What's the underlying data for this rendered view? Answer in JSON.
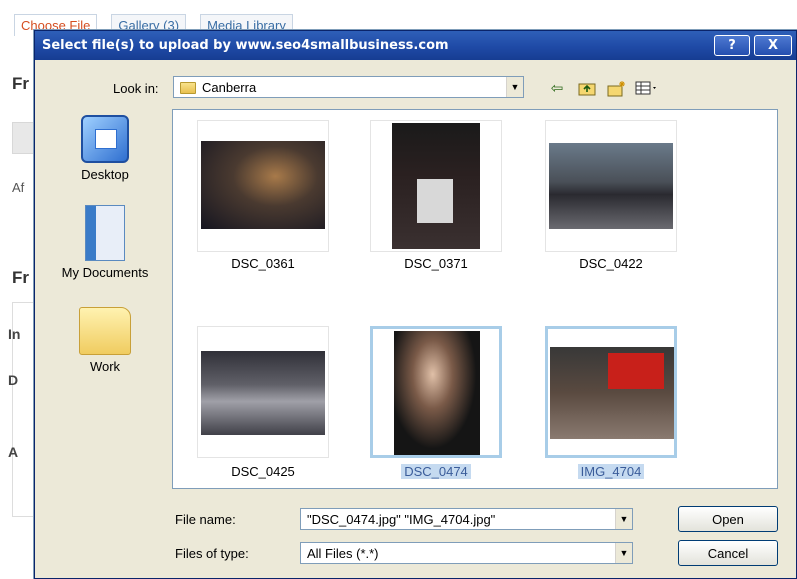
{
  "background": {
    "tabs": [
      "Choose File",
      "Gallery (3)",
      "Media Library"
    ],
    "headings": [
      "Fr",
      "Fr"
    ],
    "text": "Af",
    "panel_labels": [
      "In",
      "D",
      "A"
    ]
  },
  "dialog": {
    "title": "Select file(s) to upload by www.seo4smallbusiness.com",
    "help_label": "?",
    "close_label": "X",
    "look_in_label": "Look in:",
    "look_in_value": "Canberra",
    "toolbar_icons": [
      "back-icon",
      "up-folder-icon",
      "new-folder-icon",
      "view-menu-icon"
    ],
    "places": [
      {
        "label": "Desktop",
        "icon": "desktop-icon"
      },
      {
        "label": "My Documents",
        "icon": "my-documents-icon"
      },
      {
        "label": "Work",
        "icon": "folder-icon"
      }
    ],
    "files": [
      {
        "name": "DSC_0361",
        "selected": false
      },
      {
        "name": "DSC_0371",
        "selected": false
      },
      {
        "name": "DSC_0422",
        "selected": false
      },
      {
        "name": "DSC_0425",
        "selected": false
      },
      {
        "name": "DSC_0474",
        "selected": true
      },
      {
        "name": "IMG_4704",
        "selected": true
      }
    ],
    "file_name_label": "File name:",
    "file_name_value": "\"DSC_0474.jpg\" \"IMG_4704.jpg\"",
    "file_type_label": "Files of type:",
    "file_type_value": "All Files (*.*)",
    "open_label": "Open",
    "cancel_label": "Cancel"
  },
  "colors": {
    "titlebar": "#1f4aa6",
    "dialog_bg": "#ece9d8",
    "selection": "#c5daf0"
  }
}
